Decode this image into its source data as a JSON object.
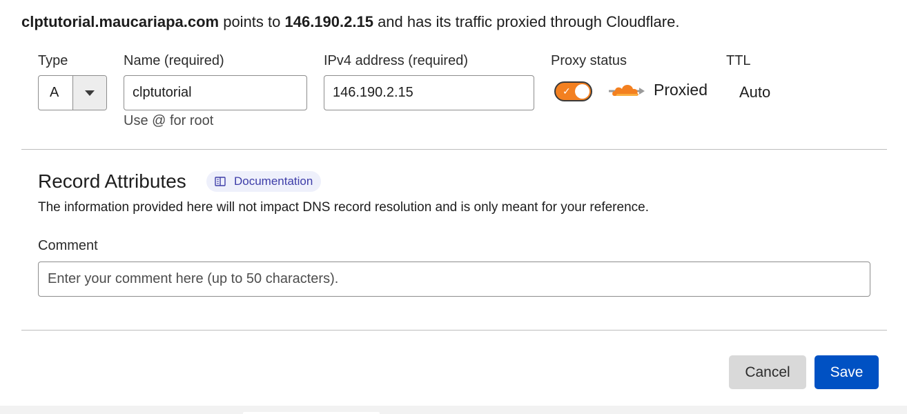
{
  "summary": {
    "domain": "clptutorial.maucariapa.com",
    "text1": " points to ",
    "ip": "146.190.2.15",
    "text2": " and has its traffic proxied through Cloudflare."
  },
  "form": {
    "type_label": "Type",
    "type_value": "A",
    "name_label": "Name (required)",
    "name_value": "clptutorial",
    "name_hint": "Use @ for root",
    "ipv4_label": "IPv4 address (required)",
    "ipv4_value": "146.190.2.15",
    "proxy_label": "Proxy status",
    "proxy_on": true,
    "proxy_text": "Proxied",
    "ttl_label": "TTL",
    "ttl_value": "Auto"
  },
  "attributes": {
    "title": "Record Attributes",
    "doc_link": "Documentation",
    "description": "The information provided here will not impact DNS record resolution and is only meant for your reference.",
    "comment_label": "Comment",
    "comment_placeholder": "Enter your comment here (up to 50 characters).",
    "comment_value": ""
  },
  "actions": {
    "cancel": "Cancel",
    "save": "Save"
  },
  "colors": {
    "accent_orange": "#f38020",
    "save_blue": "#0051c3",
    "doc_pill_bg": "#eef0fb",
    "doc_link": "#3d3da8"
  },
  "icons": {
    "type_caret": "caret-down-icon",
    "toggle_check": "check-icon",
    "cloud": "cloud-proxied-icon",
    "doc": "book-icon"
  }
}
